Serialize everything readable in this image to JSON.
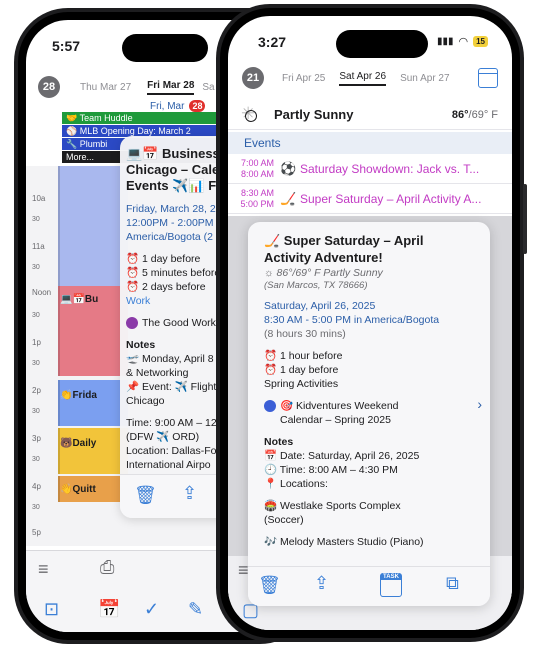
{
  "back_phone": {
    "status_time": "5:57",
    "week_badge": "28",
    "days": [
      "Thu Mar 27",
      "Fri Mar 28",
      "Sa"
    ],
    "date_header": "Fri, Mar",
    "date_badge": "28",
    "allday_events": [
      {
        "label": "Team Huddle",
        "color": "#1f9a3b",
        "emoji": "🤝"
      },
      {
        "label": "MLB Opening Day: March 2",
        "color": "#2b49c4",
        "emoji": "⚾"
      },
      {
        "label": "Plumbi",
        "color": "#2b49c4",
        "emoji": "🔧"
      },
      {
        "label": "More...",
        "color": "#1c1c1e",
        "emoji": ""
      }
    ],
    "hours": [
      "10a",
      "30",
      "11a",
      "30",
      "Noon",
      "30",
      "1p",
      "30",
      "2p",
      "30",
      "3p",
      "30",
      "4p",
      "30",
      "5p",
      "30"
    ],
    "timeline_events": [
      {
        "label": "Bu",
        "emoji": "💻📅"
      },
      {
        "label": "Frida",
        "emoji": "👏"
      },
      {
        "label": "Daily",
        "emoji": "🐻"
      },
      {
        "label": "Quitt",
        "emoji": "👋"
      }
    ],
    "popover": {
      "title_lines": [
        "💻📅 Business",
        "Chicago – Calen",
        "Events ✈️📊 Fligh"
      ],
      "date_line": "Friday, March 28, 20",
      "time_line": "12:00PM - 2:00PM",
      "tz_line": "America/Bogota (2 h",
      "alerts": [
        "⏰ 1 day before",
        "⏰ 5 minutes before",
        "⏰ 2 days before"
      ],
      "calendar_tag": "Work",
      "calendar_name": "The Good Work s",
      "notes_label": "Notes",
      "notes": [
        "🛫 Monday, April 8 -",
        "& Networking",
        "📌 Event: ✈️ Flight",
        "Chicago",
        "",
        "Time: 9:00 AM – 12:",
        "(DFW ✈️ ORD)",
        "Location: Dallas-For",
        "International Airpo"
      ]
    }
  },
  "front_phone": {
    "status_time": "3:27",
    "battery": "15",
    "week_badge": "21",
    "days": [
      "Fri Apr 25",
      "Sat Apr 26",
      "Sun Apr 27"
    ],
    "weather": {
      "summary": "Partly Sunny",
      "high": "86°",
      "low": "/69° F"
    },
    "events_header": "Events",
    "events": [
      {
        "start": "7:00 AM",
        "end": "8:00 AM",
        "emoji": "⚽",
        "title": "Saturday Showdown: Jack vs. T..."
      },
      {
        "start": "8:30 AM",
        "end": "5:00 PM",
        "emoji": "🏒",
        "title": "Super Saturday – April Activity A..."
      }
    ],
    "detail": {
      "title_line1": "🏒 Super Saturday – April",
      "title_line2": "Activity Adventure!",
      "weather_line": "☼ 86°/69° F  Partly Sunny",
      "location_line": "(San Marcos, TX 78666)",
      "date_line": "Saturday, April 26, 2025",
      "time_line": "8:30 AM - 5:00 PM in America/Bogota",
      "duration_line": "(8 hours 30 mins)",
      "alerts": [
        "⏰ 1 hour before",
        "⏰ 1 day before"
      ],
      "category": "Spring Activities",
      "calendar_line1": "🎯 Kidventures Weekend",
      "calendar_line2": "Calendar – Spring 2025",
      "calendar_color": "#3b5fd6",
      "notes_label": "Notes",
      "notes": [
        "📅 Date: Saturday, April 26, 2025",
        "🕘 Time: 8:00 AM – 4:30 PM",
        "📍 Locations:",
        "",
        "🏟️ Westlake Sports Complex",
        "(Soccer)",
        "",
        "🎶 Melody Masters Studio (Piano)"
      ],
      "task_label": "TASK"
    }
  },
  "colors": {
    "accent": "#3b7fd6",
    "event_magenta": "#c23bc4",
    "link_blue": "#2b5ea8"
  }
}
